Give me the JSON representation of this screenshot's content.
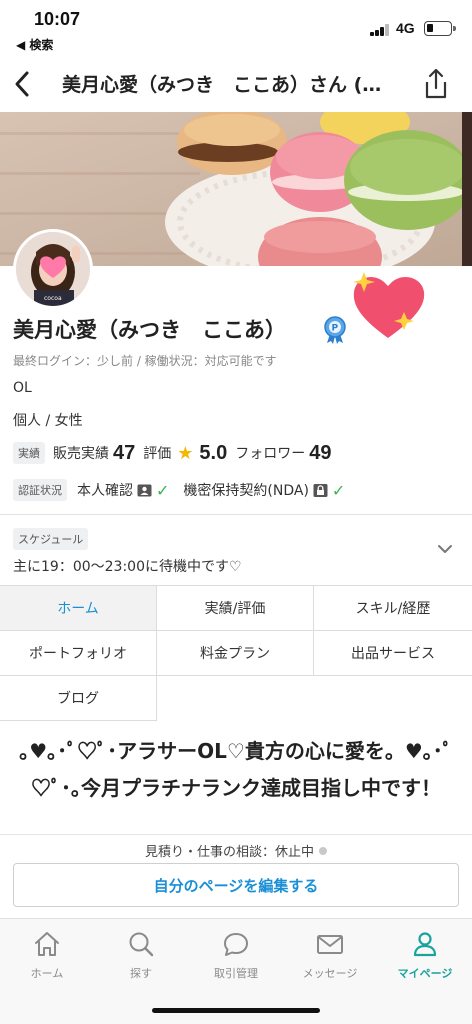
{
  "status_bar": {
    "time": "10:07",
    "back_app": "◀ 検索",
    "network": "4G"
  },
  "header": {
    "title": "美月心愛（みつき　ここあ）さん (…",
    "back_icon": "chevron-left-icon",
    "share_icon": "share-icon"
  },
  "profile": {
    "avatar_text": "cocoa",
    "name": "美月心愛（みつき　ここあ）",
    "meta": "最終ログイン：少し前  /  稼働状況：対応可能です",
    "occupation": "OL",
    "type": "個人 / 女性"
  },
  "stats": {
    "tag": "実績",
    "sales_label": "販売実績",
    "sales_value": "47",
    "rating_label": "評価",
    "rating_value": "5.0",
    "followers_label": "フォロワー",
    "followers_value": "49"
  },
  "verification": {
    "tag": "認証状況",
    "identity_label": "本人確認",
    "nda_label": "機密保持契約(NDA)"
  },
  "schedule": {
    "tag": "スケジュール",
    "text": "主に19：00〜23:00に待機中です♡"
  },
  "tabs": [
    {
      "label": "ホーム",
      "active": true
    },
    {
      "label": "実績/評価",
      "active": false
    },
    {
      "label": "スキル/経歴",
      "active": false
    },
    {
      "label": "ポートフォリオ",
      "active": false
    },
    {
      "label": "料金プラン",
      "active": false
    },
    {
      "label": "出品サービス",
      "active": false
    },
    {
      "label": "ブログ",
      "active": false
    }
  ],
  "headline": "｡♥｡･ﾟ♡ﾟ･アラサーOL♡貴方の心に愛を。♥｡･ﾟ♡ﾟ･｡今月プラチナランク達成目指し中です！",
  "cta": {
    "status_text": "見積り・仕事の相談：休止中",
    "edit_button": "自分のページを編集する"
  },
  "tabbar": {
    "items": [
      {
        "label": "ホーム",
        "icon": "home-icon"
      },
      {
        "label": "探す",
        "icon": "search-icon"
      },
      {
        "label": "取引管理",
        "icon": "chat-bubble-icon"
      },
      {
        "label": "メッセージ",
        "icon": "mail-icon"
      },
      {
        "label": "マイページ",
        "icon": "person-icon"
      }
    ],
    "active_color": "#1aa39a"
  },
  "colors": {
    "accent_blue": "#1a8fd6",
    "check_green": "#3ab35a",
    "star_yellow": "#f5b800"
  }
}
